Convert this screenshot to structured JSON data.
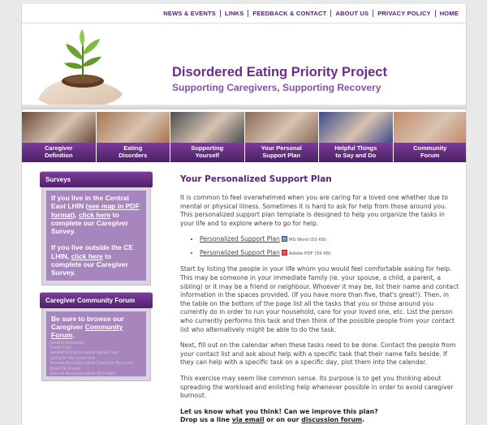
{
  "topnav": {
    "items": [
      "NEWS & EVENTS",
      "LINKS",
      "FEEDBACK & CONTACT",
      "ABOUT US",
      "PRIVACY POLICY",
      "HOME"
    ]
  },
  "header": {
    "title": "Disordered Eating Priority Project",
    "subtitle": "Supporting Caregivers, Supporting Recovery"
  },
  "photonav": [
    {
      "label": "Caregiver\nDefinition",
      "color": "#6a4a3a"
    },
    {
      "label": "Eating\nDisorders",
      "color": "#a7764f"
    },
    {
      "label": "Supporting\nYourself",
      "color": "#4b4f55"
    },
    {
      "label": "Your Personal\nSupport Plan",
      "color": "#8a6a58"
    },
    {
      "label": "Helpful Things\nto Say and Do",
      "color": "#3d4d8a"
    },
    {
      "label": "Community\nForum",
      "color": "#c48a6a"
    }
  ],
  "sidebar": {
    "surveys_title": "Surveys",
    "survey1_a": "If you live in the Central East LHIN (",
    "survey1_link1": "see map in PDF format",
    "survey1_b": "), ",
    "survey1_link2": "click here",
    "survey1_c": " to complete our Caregiver Survey.",
    "survey2_a": "If you live outside the CE LHIN, ",
    "survey2_link": "click here",
    "survey2_b": " to complete our Caregiver Survey.",
    "forum_title": "Caregiver Community Forum",
    "forum_a": "Be sure to browse our Caregiver ",
    "forum_link": "Community Forum",
    "forum_b": ".",
    "forum_ghost": "General discussion\nFamily Care\nGeneral discussion about Family Care\nCaring for My Loved One\nGeneral discussion about Caring for My Loved\nAbout DE Project\nGeneral discussion about DE Project"
  },
  "main": {
    "heading": "Your Personalized Support Plan",
    "intro": "It is common to feel overwhelmed when you are caring for a loved one whether due to mental or physical illness. Sometimes it is hard to ask for help from those around you. This personalized support plan template is designed to help you organize the tasks in your life and to explore where to go for help.",
    "downloads": [
      {
        "link": "Personalized Support Plan",
        "note": "MS Word (50 KB)",
        "icon": "word-doc-icon"
      },
      {
        "link": "Personalized Support Plan",
        "note": "Adobe PDF (59 KB)",
        "icon": "pdf-icon"
      }
    ],
    "para2": "Start by listing the people in your life whom you would feel comfortable asking for help. This may be someone in your immediate family (ie. your spouse, a child, a parent, a sibling) or it may be a friend or neighbour. Whoever it may be, list their name and contact information in the spaces provided. (If you have more than five, that's great!). Then, in the table on the bottom of the page list all the tasks that you or those around you currently do in order to run your household, care for your loved one, etc. List the person who currently performs this task and then think of the possible people from your contact list who alternatively might be able to do the task.",
    "para3": "Next, fill out on the calendar when these tasks need to be done. Contact the people from your contact list and ask about help with a specific task that their name falls beside. If they can help with a specific task on a specific day, plot them into the calendar.",
    "para4": "This exercise may seem like common sense. Its purpose is to get you thinking about spreading the workload and enlisting help whenever possible in order to avoid caregiver burnout.",
    "cta_line1": "Let us know what you think! Can we improve this plan?",
    "cta_a": "Drop us a line ",
    "cta_link1": "via email",
    "cta_b": " or on our ",
    "cta_link2": "discussion forum",
    "cta_c": "."
  },
  "colors": {
    "purple_dark": "#4d1f66",
    "purple_title": "#6b2c8a",
    "sidebar_bg": "#dcd2e5",
    "sidebar_inner": "#a786bd"
  }
}
